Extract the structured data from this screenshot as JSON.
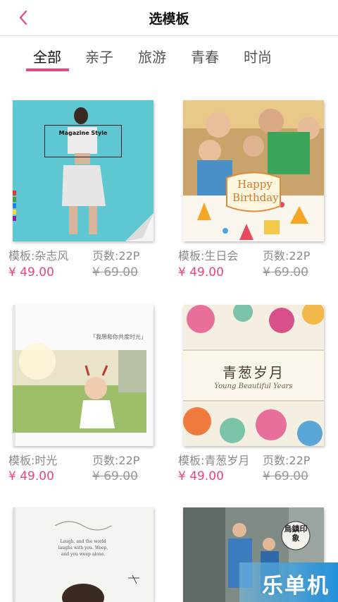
{
  "header": {
    "title": "选模板"
  },
  "tabs": [
    {
      "label": "全部"
    },
    {
      "label": "亲子"
    },
    {
      "label": "旅游"
    },
    {
      "label": "青春"
    },
    {
      "label": "时尚"
    }
  ],
  "templates": [
    {
      "name": "模板:杂志风",
      "pages": "页数:22P",
      "price": "¥ 49.00",
      "old_price": "¥ 69.00",
      "cover_text": "Magazine Style"
    },
    {
      "name": "模板:生日会",
      "pages": "页数:22P",
      "price": "¥ 49.00",
      "old_price": "¥ 69.00",
      "cover_text": "Happy Birthday"
    },
    {
      "name": "模板:时光",
      "pages": "页数:22P",
      "price": "¥ 49.00",
      "old_price": "¥ 69.00",
      "cover_text": "「我想和你共度时光」"
    },
    {
      "name": "模板:青葱岁月",
      "pages": "页数:22P",
      "price": "¥ 49.00",
      "old_price": "¥ 69.00",
      "cover_text": "青葱岁月",
      "cover_subtext": "Young Beautiful Years"
    },
    {
      "name": "",
      "pages": "",
      "price": "",
      "old_price": "",
      "cover_text": "Laugh, and the world laughs with you. Weep, and you weep alone."
    },
    {
      "name": "",
      "pages": "",
      "price": "",
      "old_price": "",
      "cover_text": "烏鎮印象"
    }
  ],
  "watermark": {
    "text": "乐单机"
  },
  "colors": {
    "accent": "#e8457a",
    "header_border": "#e6e6e6",
    "meta_text": "#8a8a8a"
  }
}
